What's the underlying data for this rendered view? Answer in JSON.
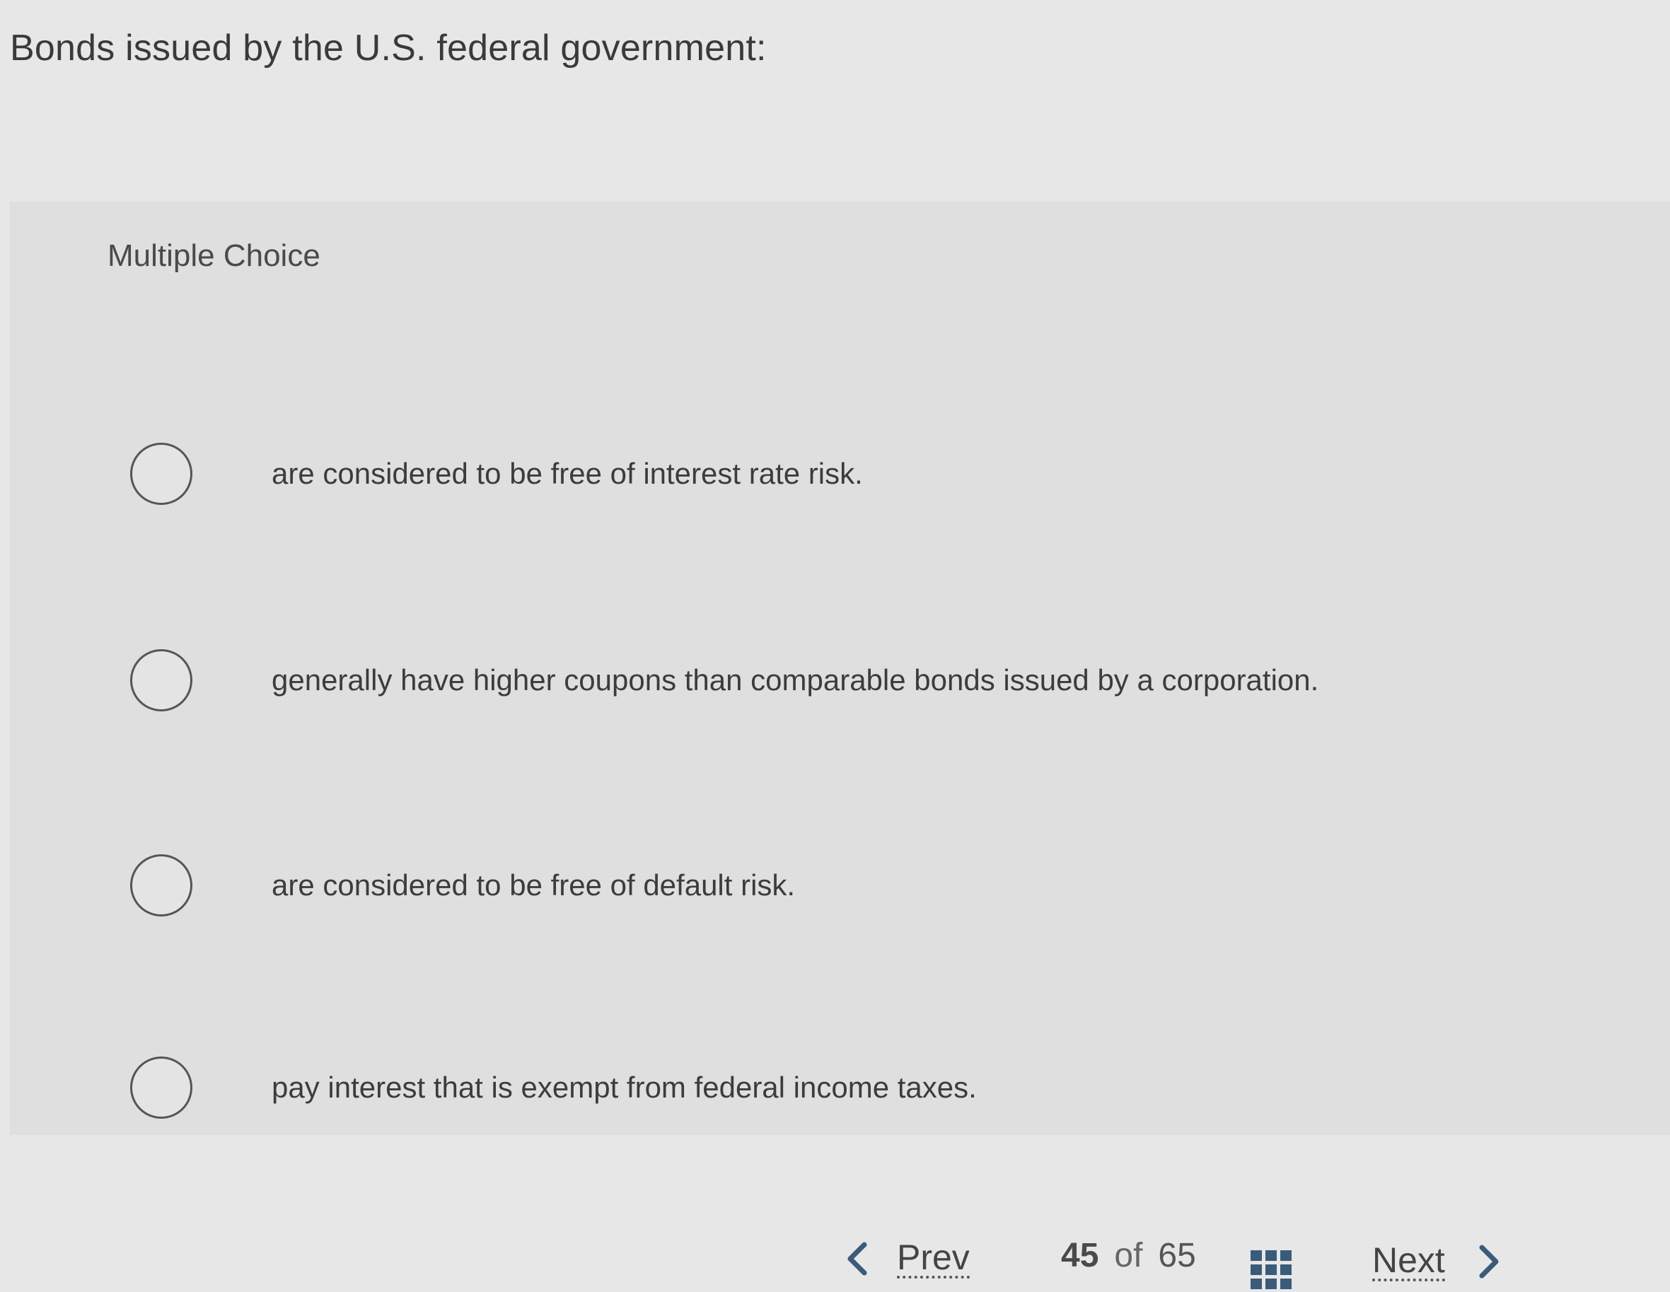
{
  "question": {
    "text": "Bonds issued by the U.S. federal government:"
  },
  "multiple_choice": {
    "label": "Multiple Choice",
    "options": [
      {
        "text": "are considered to be free of interest rate risk.",
        "selected": false
      },
      {
        "text": "generally have higher coupons than comparable bonds issued by a corporation.",
        "selected": false
      },
      {
        "text": "are considered to be free of default risk.",
        "selected": false
      },
      {
        "text": "pay interest that is exempt from federal income taxes.",
        "selected": false
      }
    ]
  },
  "navigation": {
    "prev_label": "Prev",
    "current_page": "45",
    "of_label": "of",
    "total_pages": "65",
    "next_label": "Next",
    "prev_icon": "chevron-left-icon",
    "grid_icon": "grid-icon",
    "next_icon": "chevron-right-icon",
    "accent_color": "#3b5b7a"
  }
}
